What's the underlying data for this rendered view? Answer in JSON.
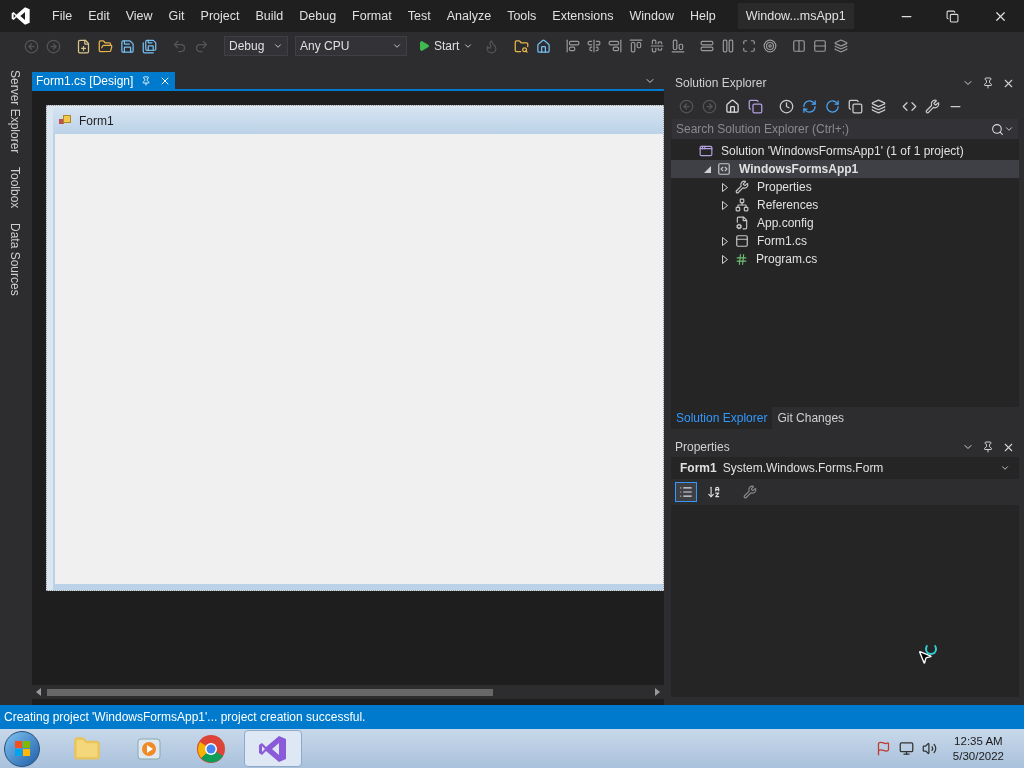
{
  "window": {
    "title": "Window...msApp1"
  },
  "menu": [
    "File",
    "Edit",
    "View",
    "Git",
    "Project",
    "Build",
    "Debug",
    "Format",
    "Test",
    "Analyze",
    "Tools",
    "Extensions",
    "Window",
    "Help"
  ],
  "toolbar": {
    "configuration": "Debug",
    "platform": "Any CPU",
    "start": "Start"
  },
  "left_tabs": [
    "Server Explorer",
    "Toolbox",
    "Data Sources"
  ],
  "document_tabs": [
    {
      "label": "Form1.cs [Design]",
      "selected": true
    }
  ],
  "designer": {
    "form_title": "Form1"
  },
  "solution_explorer": {
    "title": "Solution Explorer",
    "search": {
      "placeholder": "Search Solution Explorer (Ctrl+;)"
    },
    "tree": [
      {
        "label": "Solution 'WindowsFormsApp1' (1 of 1 project)",
        "kind": "solution",
        "selected": false,
        "children": [
          {
            "label": "WindowsFormsApp1",
            "kind": "project",
            "selected": true,
            "expanded": true,
            "children": [
              {
                "label": "Properties",
                "kind": "properties",
                "selected": false,
                "expanded": false
              },
              {
                "label": "References",
                "kind": "references",
                "selected": false,
                "expanded": false
              },
              {
                "label": "App.config",
                "kind": "config",
                "selected": false
              },
              {
                "label": "Form1.cs",
                "kind": "form",
                "selected": false,
                "expanded": false
              },
              {
                "label": "Program.cs",
                "kind": "csharp",
                "selected": false,
                "expanded": false
              }
            ]
          }
        ]
      }
    ]
  },
  "panel_tabs": [
    {
      "label": "Solution Explorer",
      "selected": true
    },
    {
      "label": "Git Changes",
      "selected": false
    }
  ],
  "properties": {
    "title": "Properties",
    "object_name": "Form1",
    "object_type": "System.Windows.Forms.Form",
    "view_buttons": [
      {
        "kind": "categorized",
        "selected": true
      },
      {
        "kind": "alphabetical",
        "selected": false
      },
      {
        "kind": "pages",
        "selected": false
      }
    ]
  },
  "status_bar": {
    "text": "Creating project 'WindowsFormsApp1'... project creation successful."
  },
  "taskbar": {
    "apps": [
      {
        "kind": "explorer",
        "selected": false
      },
      {
        "kind": "media",
        "selected": false
      },
      {
        "kind": "browser",
        "selected": false
      },
      {
        "kind": "studio",
        "selected": true
      }
    ],
    "time": "12:35 AM",
    "date": "5/30/2022"
  }
}
